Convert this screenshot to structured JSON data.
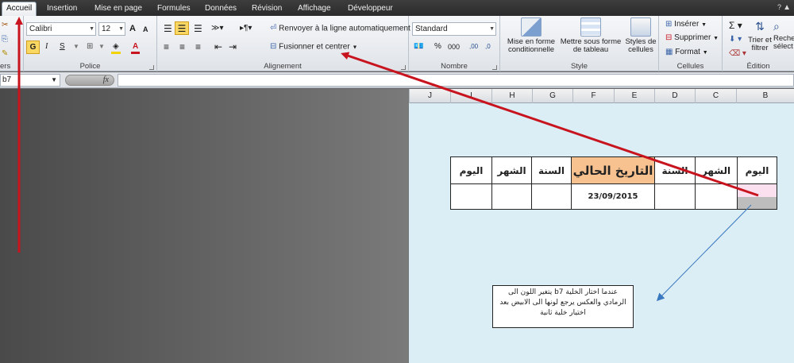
{
  "tabs": [
    "Accueil",
    "Insertion",
    "Mise en page",
    "Formules",
    "Données",
    "Révision",
    "Affichage",
    "Développeur"
  ],
  "window": {
    "minimize_glyph": "▲",
    "help_glyph": "?"
  },
  "ribbon": {
    "presse_papiers": {
      "label": "ers"
    },
    "police": {
      "label": "Police",
      "font": "Calibri",
      "size": "12",
      "bold": "G",
      "italic": "I",
      "underline": "S",
      "grow": "A",
      "shrink": "A"
    },
    "alignement": {
      "label": "Alignement",
      "wrap": "Renvoyer à la ligne automatiquement",
      "merge": "Fusionner et centrer"
    },
    "nombre": {
      "label": "Nombre",
      "format": "Standard",
      "percent": "%",
      "thousands": "000",
      "inc_dec": ",00",
      "dec_dec": ",0"
    },
    "style": {
      "label": "Style",
      "cond_format": [
        "Mise en forme",
        "conditionnelle"
      ],
      "table_format": [
        "Mettre sous forme",
        "de tableau"
      ],
      "cell_styles": [
        "Styles de",
        "cellules"
      ]
    },
    "cellules": {
      "label": "Cellules",
      "insert": "Insérer",
      "delete": "Supprimer",
      "format": "Format"
    },
    "edition": {
      "label": "Édition",
      "sort": [
        "Trier et",
        "filtrer"
      ],
      "find": [
        "Reche",
        "sélect"
      ]
    }
  },
  "formula_bar": {
    "name_box": "b7",
    "fx": "fx",
    "value": ""
  },
  "columns": [
    "J",
    "I",
    "H",
    "G",
    "F",
    "E",
    "D",
    "C",
    "B"
  ],
  "table": {
    "headers": [
      "اليوم",
      "الشهر",
      "السنة",
      "التاريخ الحالي",
      "السنة",
      "الشهر",
      "اليوم"
    ],
    "date": "23/09/2015"
  },
  "note": "عندما اختار الخلية b7 يتغير اللون الى الرمادي والعكس يرجع لونها الى الابيض بعد اختيار خلية ثانية",
  "colors": {
    "arrow": "#c8141e",
    "highlight": "#f7c28f",
    "selected_gray": "#bdbdbd",
    "sheet_bg": "#dbeef5"
  }
}
